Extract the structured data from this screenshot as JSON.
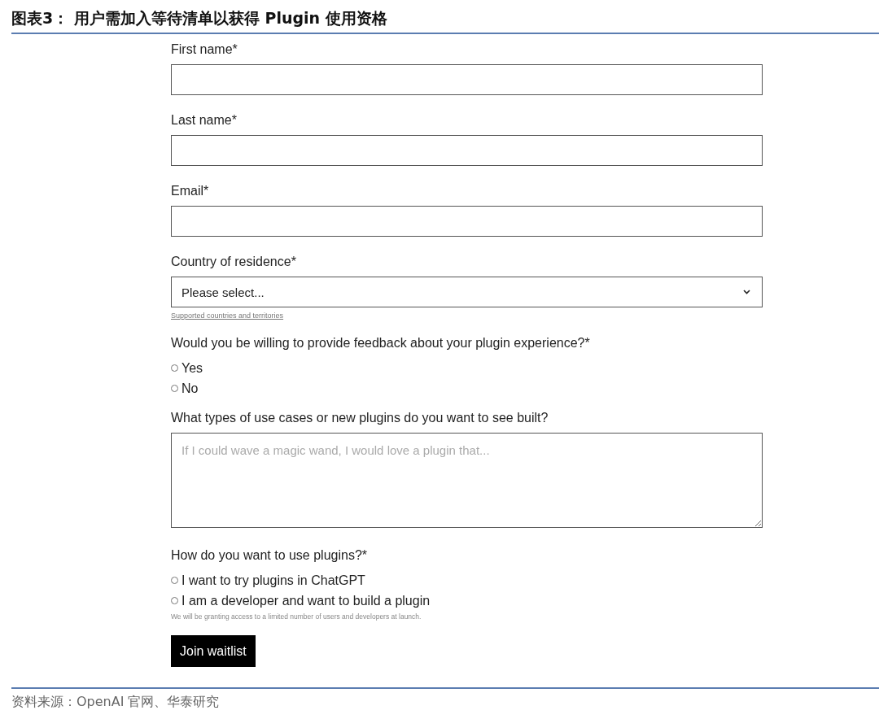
{
  "figure_title": "图表3：  用户需加入等待清单以获得 Plugin 使用资格",
  "form": {
    "fields": [
      {
        "kind": "text",
        "label": "First name*"
      },
      {
        "kind": "text",
        "label": "Last name*"
      },
      {
        "kind": "text",
        "label": "Email*"
      },
      {
        "kind": "select",
        "label": "Country of residence*",
        "value": "Please select...",
        "link": "Supported countries and territories"
      },
      {
        "kind": "radio",
        "label": "Would you be willing to provide feedback about your plugin experience?*",
        "options": [
          {
            "label": "Yes",
            "selected": false
          },
          {
            "label": "No",
            "selected": false
          }
        ]
      },
      {
        "kind": "textarea",
        "label": "What types of use cases or new plugins do you want to see built?",
        "placeholder": "If I could wave a magic wand, I would love a plugin that..."
      },
      {
        "kind": "radio",
        "label": "How do you want to use plugins?*",
        "options": [
          {
            "label": "I want to try plugins in ChatGPT",
            "selected": false
          },
          {
            "label": "I am a developer and want to build a plugin",
            "selected": false
          }
        ],
        "note": "We will be granting access to a limited number of users and developers at launch."
      }
    ],
    "submit": "Join waitlist"
  },
  "source": "资料来源：OpenAI 官网、华泰研究"
}
